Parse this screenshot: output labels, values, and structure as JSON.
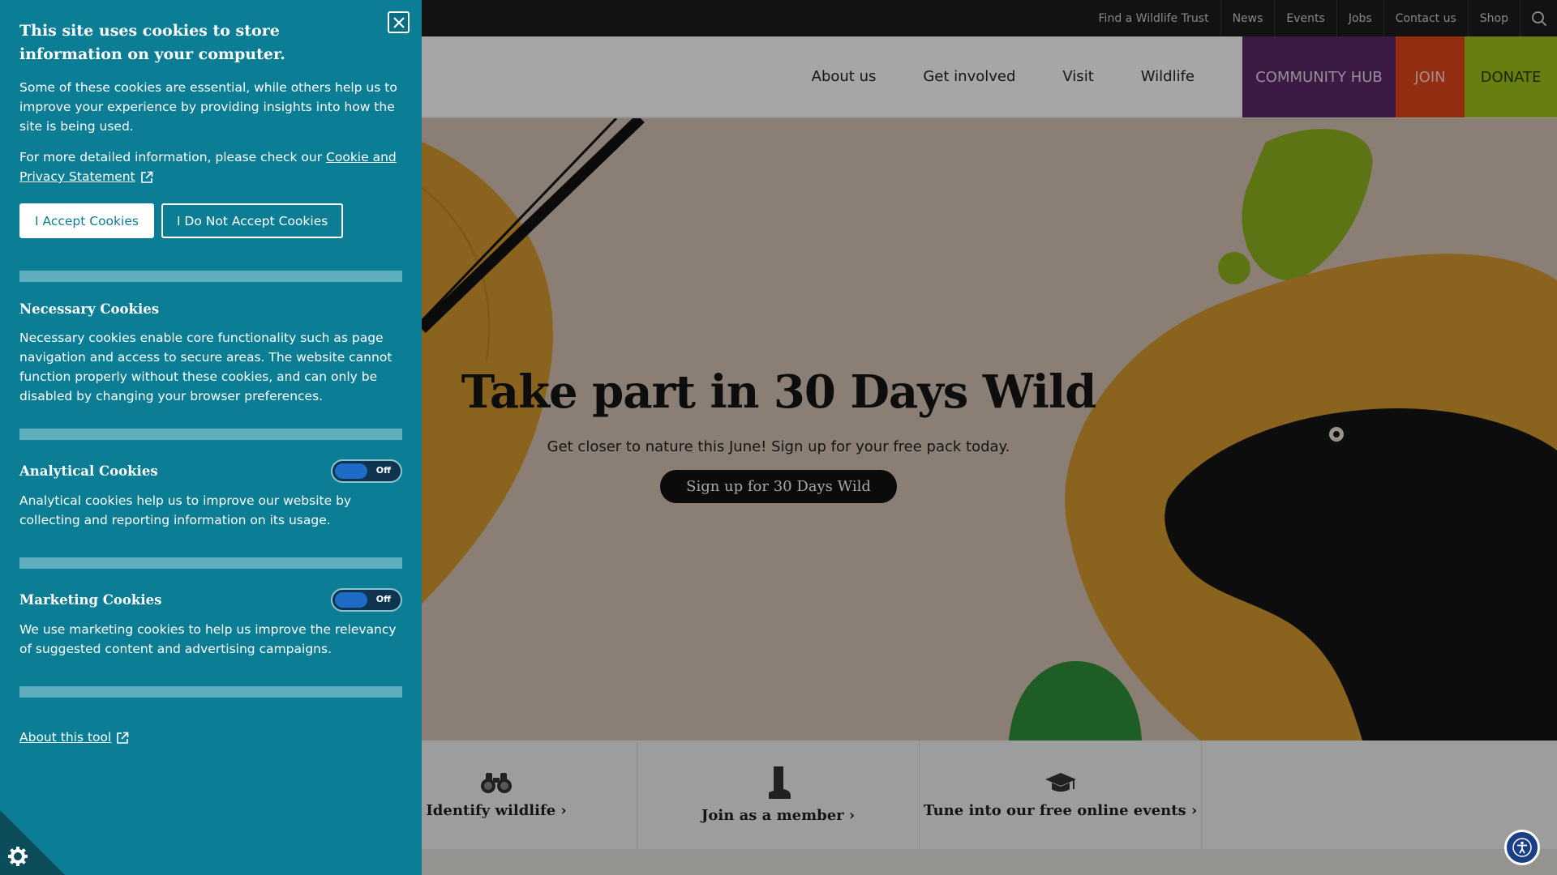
{
  "topbar": {
    "links": [
      "Find a Wildlife Trust",
      "News",
      "Events",
      "Jobs",
      "Contact us",
      "Shop"
    ]
  },
  "nav": {
    "items": [
      "About us",
      "Get involved",
      "Visit",
      "Wildlife"
    ],
    "community_hub": "COMMUNITY HUB",
    "join": "JOIN",
    "donate": "DONATE"
  },
  "hero": {
    "title": "Take part in 30 Days Wild",
    "subtitle": "Get closer to nature this June! Sign up for your free pack today.",
    "button": "Sign up for 30 Days Wild"
  },
  "quicklinks": [
    {
      "label": "Identify wildlife",
      "icon": "binoculars-icon"
    },
    {
      "label": "Join as a member",
      "icon": "boot-icon"
    },
    {
      "label": "Tune into our free online events",
      "icon": "graduation-cap-icon"
    }
  ],
  "cookie": {
    "title": "This site uses cookies to store information on your computer.",
    "intro": "Some of these cookies are essential, while others help us to improve your experience by providing insights into how the site is being used.",
    "more_info_prefix": "For more detailed information, please check our ",
    "more_info_link": "Cookie and Privacy Statement",
    "accept": "I Accept Cookies",
    "decline": "I Do Not Accept Cookies",
    "necessary_title": "Necessary Cookies",
    "necessary_text": "Necessary cookies enable core functionality such as page navigation and access to secure areas. The website cannot function properly without these cookies, and can only be disabled by changing your browser preferences.",
    "analytical_title": "Analytical Cookies",
    "analytical_state": "Off",
    "analytical_text": "Analytical cookies help us to improve our website by collecting and reporting information on its usage.",
    "marketing_title": "Marketing Cookies",
    "marketing_state": "Off",
    "marketing_text": "We use marketing cookies to help us improve the relevancy of suggested content and advertising campaigns.",
    "about_link": "About this tool"
  },
  "colors": {
    "panel": "#0b7e95",
    "community": "#5b2a67",
    "join": "#e0451d",
    "donate": "#9fc319"
  }
}
